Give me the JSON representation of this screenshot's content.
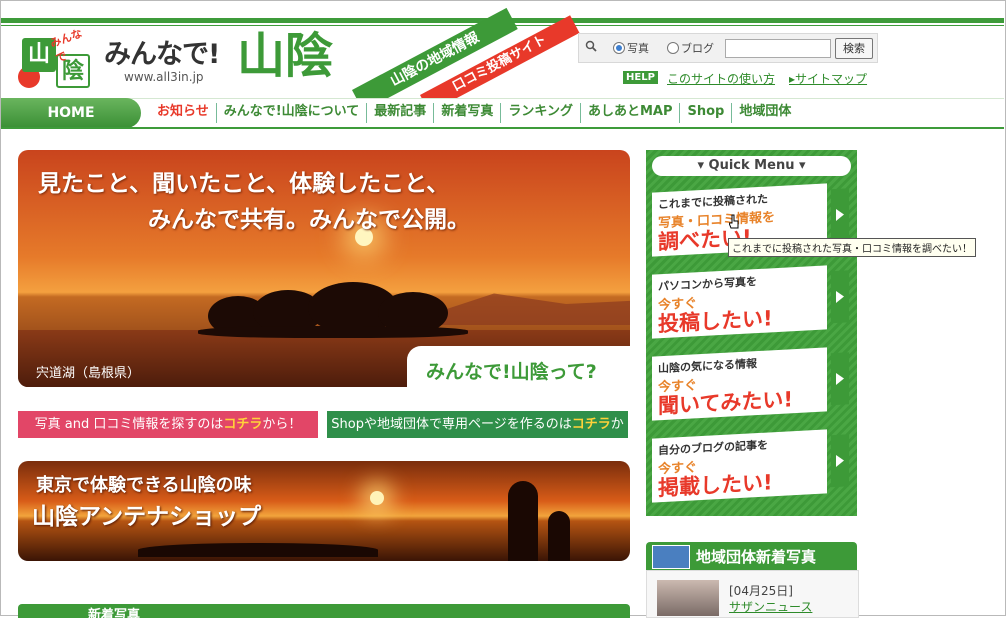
{
  "header": {
    "logo_char1": "山",
    "logo_char2": "陰",
    "logo_small": "みんなで",
    "site_name": "みんなで!",
    "site_big": "山陰",
    "url": "www.all3in.jp",
    "ribbon_green": "山陰の地域情報",
    "ribbon_red": "口コミ投稿サイト"
  },
  "search": {
    "option_photo": "写真",
    "option_blog": "ブログ",
    "button": "検索",
    "selected": "写真"
  },
  "help": {
    "badge": "HELP",
    "usage_link": "このサイトの使い方",
    "sitemap_link": "サイトマップ"
  },
  "nav": {
    "home": "HOME",
    "items": [
      "お知らせ",
      "みんなで!山陰について",
      "最新記事",
      "新着写真",
      "ランキング",
      "あしあとMAP",
      "Shop",
      "地域団体"
    ]
  },
  "hero": {
    "line1": "見たこと、聞いたこと、体験したこと、",
    "line2": "みんなで共有。みんなで公開。",
    "caption": "宍道湖（島根県）",
    "tab": "みんなで!山陰って?"
  },
  "buttons": {
    "pink_pre": "写真 and 口コミ情報を探すのは",
    "pink_hl": "コチラ",
    "pink_post": "から！",
    "green_pre": "Shopや地域団体で専用ページを作るのは",
    "green_hl": "コチラ",
    "green_post": "から！"
  },
  "antenna": {
    "line1": "東京で体験できる山陰の味",
    "line2": "山陰アンテナショップ"
  },
  "news": {
    "heading": "新着写真"
  },
  "quick_menu": {
    "title": "Quick Menu",
    "cards": [
      {
        "sm": "これまでに投稿された",
        "mid": "写真・口コミ情報を",
        "big": "調べたい!"
      },
      {
        "sm": "パソコンから写真を",
        "mid": "今すぐ",
        "big": "投稿したい!"
      },
      {
        "sm": "山陰の気になる情報",
        "mid": "今すぐ",
        "big": "聞いてみたい!"
      },
      {
        "sm": "自分のブログの記事を",
        "mid": "今すぐ",
        "big": "掲載したい!"
      }
    ],
    "tooltip": "これまでに投稿された写真・口コミ情報を調べたい！"
  },
  "region": {
    "heading": "地域団体新着写真",
    "date": "[04月25日]",
    "link": "サザンニュース"
  },
  "colors": {
    "brand_green": "#3d9a38",
    "accent_red": "#e8392a",
    "pink_button": "#e24667",
    "green_button": "#2f8f4a"
  }
}
